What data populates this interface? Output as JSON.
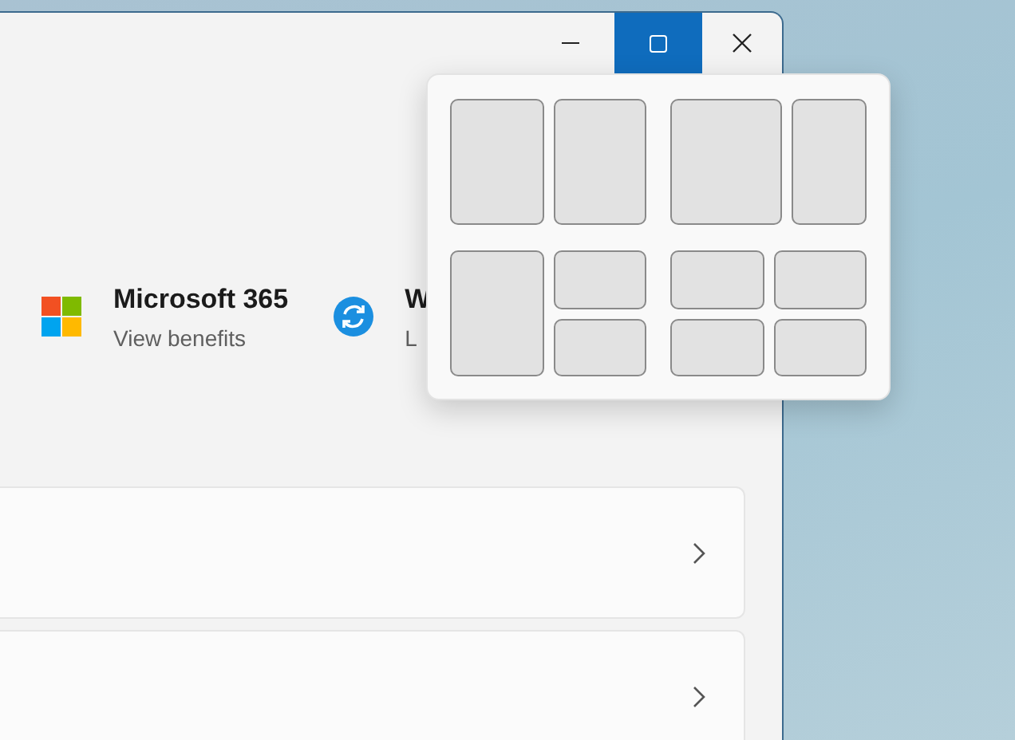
{
  "window": {
    "caption_buttons": [
      {
        "kind": "minimize",
        "highlighted": false
      },
      {
        "kind": "maximize",
        "highlighted": true
      },
      {
        "kind": "close",
        "highlighted": false
      }
    ]
  },
  "products": [
    {
      "kind": "microsoft",
      "title": "Microsoft 365",
      "subtitle": "View benefits"
    },
    {
      "kind": "sync",
      "title": "W",
      "subtitle": "L"
    }
  ],
  "cards": [
    {
      "kind": "chevron"
    },
    {
      "kind": "chevron"
    }
  ],
  "snap_layouts": [
    {
      "kind": "halves"
    },
    {
      "kind": "wide-left"
    },
    {
      "kind": "left-and-stack"
    },
    {
      "kind": "quarters"
    }
  ]
}
